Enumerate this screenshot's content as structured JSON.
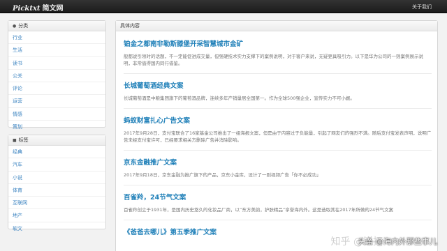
{
  "header": {
    "brand_en": "Picktxt",
    "brand_cn": "简文网",
    "about": "关于我们"
  },
  "categories": {
    "title": "分类",
    "icon": "home-icon",
    "items": [
      {
        "label": "行业"
      },
      {
        "label": "生活"
      },
      {
        "label": "读书"
      },
      {
        "label": "公关"
      },
      {
        "label": "评论"
      },
      {
        "label": "运营"
      },
      {
        "label": "情感"
      },
      {
        "label": "策划"
      }
    ]
  },
  "tags": {
    "title": "标签",
    "icon": "tag-icon",
    "items": [
      {
        "label": "经典"
      },
      {
        "label": "汽车"
      },
      {
        "label": "小说"
      },
      {
        "label": "体育"
      },
      {
        "label": "互联网"
      },
      {
        "label": "地产"
      },
      {
        "label": "软文"
      }
    ]
  },
  "main": {
    "title": "具体内容",
    "articles": [
      {
        "title": "铂金之都南非勒斯滕堡开采智慧城市金矿",
        "body": "般都说引领时的话题，不一定能促进成交量，但强硬技术实力支撑下的案例说明，对于客户来说，无疑更具吸引力。以下是华为公司的一则案例展示说明，非常值得国内同行借鉴。"
      },
      {
        "title": "长城葡萄酒经典文案",
        "body": "长城葡萄酒是中粮集团旗下的葡萄酒品牌，连续多年产销量居全国第一。作为全球500强企业，宣传实力不可小觑。"
      },
      {
        "title": "蚂蚁财富扎心广告文案",
        "body": "2017年9月28日，支付宝联合了16家基金公司推出了一组海报文案，但是由于内容过于负能量，引起了网友们的强烈不满。随后支付宝发表声明，说明广告未经支付宝许可，已经要求相关方删除广告并消除影响。"
      },
      {
        "title": "京东金融推广文案",
        "body": "2017年9月18日，京东金融为推广旗下的产品，京东小金库，设计了一则视频广告「你不必成功」"
      },
      {
        "title": "百雀羚，24节气文案",
        "body": "百雀羚创立于1931年，是国内历史悠久的化妆品厂商，以“东方美韵，护肤精品”享誉海内外。这是选取其在2017年所做的24节气文案"
      },
      {
        "title": "《爸爸去哪儿》第五季推广文案",
        "body": ""
      }
    ]
  },
  "watermark": {
    "text": "头条 @海内外那些事儿",
    "faint": "知乎 @锐拓"
  }
}
